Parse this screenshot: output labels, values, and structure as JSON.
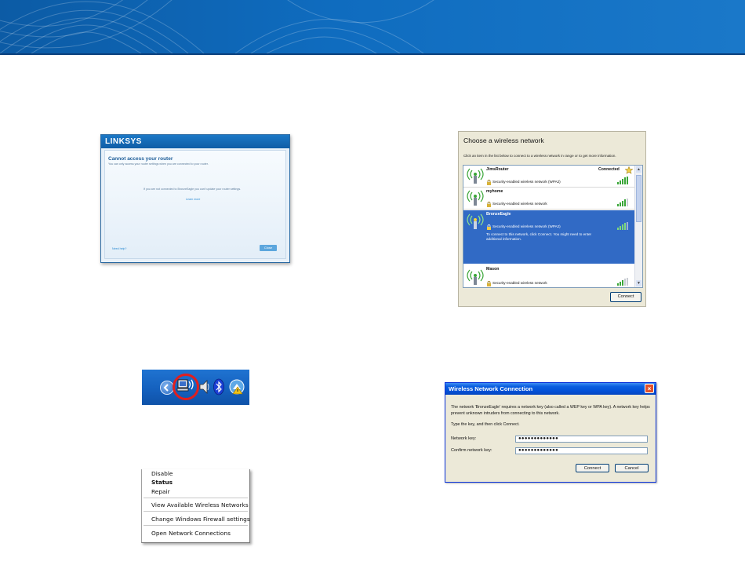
{
  "colors": {
    "banner": "#0f6cbf",
    "linksys_blue": "#1b78c6",
    "highlight_circle": "#e01f1f",
    "xp_selection": "#316ac5",
    "xp_titlebar": "#0a5ee0"
  },
  "linksys": {
    "logo": "LINKSYS",
    "title": "Cannot access your router",
    "subtitle": "You can only access your router settings when you are connected to your router.",
    "message": "If you are not connected to BronzeEagle you can't update your router settings.",
    "learn_more": "Learn more",
    "need_help": "Need help?",
    "close": "Close"
  },
  "taskbar": {
    "icons": [
      "chevron-left-icon",
      "wireless-network-icon",
      "speaker-icon",
      "bluetooth-icon",
      "safely-remove-warning-icon"
    ]
  },
  "context_menu": {
    "items": [
      {
        "label": "Disable",
        "bold": false
      },
      {
        "label": "Status",
        "bold": true
      },
      {
        "label": "Repair",
        "bold": false
      },
      {
        "label": "View Available Wireless Networks",
        "bold": false
      },
      {
        "label": "Change Windows Firewall settings",
        "bold": false
      },
      {
        "label": "Open Network Connections",
        "bold": false
      }
    ]
  },
  "choose_network": {
    "title": "Choose a wireless network",
    "description": "Click an item in the list below to connect to a wireless network in range or to get more information.",
    "networks": [
      {
        "name": "JimsRouter",
        "security": "Security-enabled wireless network (WPA2)",
        "status": "Connected",
        "selected": false
      },
      {
        "name": "myhome",
        "security": "Security-enabled wireless network",
        "status": "",
        "selected": false
      },
      {
        "name": "BronzeEagle",
        "security": "Security-enabled wireless network (WPA2)",
        "status": "",
        "selected": true,
        "extra": "To connect to this network, click Connect. You might need to enter additional information."
      },
      {
        "name": "Mason",
        "security": "Security-enabled wireless network",
        "status": "",
        "selected": false
      }
    ],
    "connect": "Connect"
  },
  "wireless_dialog": {
    "title": "Wireless Network Connection",
    "text1": "The network 'BronzeEagle' requires a network key (also called a WEP key or WPA key). A network key helps prevent unknown intruders from connecting to this network.",
    "text2": "Type the key, and then click Connect.",
    "network_key_label": "Network key:",
    "network_key_value": "●●●●●●●●●●●●●",
    "confirm_key_label": "Confirm network key:",
    "confirm_key_value": "●●●●●●●●●●●●●",
    "connect": "Connect",
    "cancel": "Cancel"
  }
}
